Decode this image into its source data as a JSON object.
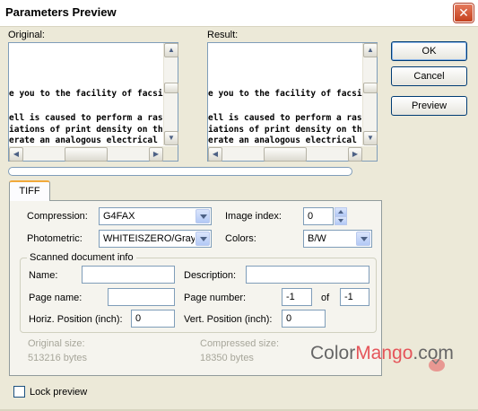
{
  "window": {
    "title": "Parameters Preview",
    "close_symbol": "✕"
  },
  "preview": {
    "original_label": "Original:",
    "result_label": "Result:",
    "lines": [
      "e you to the facility of facsimi",
      "ell is caused to perform a raste",
      "iations of print density on the ",
      "erate an analogous electrical vi"
    ]
  },
  "buttons": {
    "ok": "OK",
    "cancel": "Cancel",
    "preview": "Preview"
  },
  "progress": {
    "value": 0
  },
  "tabs": [
    {
      "label": "TIFF",
      "selected": true
    }
  ],
  "tiff": {
    "compression_label": "Compression:",
    "compression_value": "G4FAX",
    "photometric_label": "Photometric:",
    "photometric_value": "WHITEISZERO/Gray",
    "image_index_label": "Image index:",
    "image_index_value": "0",
    "colors_label": "Colors:",
    "colors_value": "B/W",
    "scanned_title": "Scanned document info",
    "name_label": "Name:",
    "name_value": "",
    "description_label": "Description:",
    "description_value": "",
    "page_name_label": "Page name:",
    "page_name_value": "",
    "page_number_label": "Page number:",
    "page_number_value": "-1",
    "of_label": "of",
    "page_total_value": "-1",
    "horiz_label": "Horiz. Position (inch):",
    "horiz_value": "0",
    "vert_label": "Vert. Position (inch):",
    "vert_value": "0",
    "original_size_label": "Original size:",
    "original_size_value": "513216 bytes",
    "compressed_size_label": "Compressed size:",
    "compressed_size_value": "18350 bytes"
  },
  "lock_preview": {
    "label": "Lock preview",
    "checked": false
  },
  "watermark": {
    "part1": "Color",
    "part2": "Mango",
    "part3": ".com"
  },
  "colors": {
    "titlebar_close": "#c4401d",
    "tab_accent": "#f1a93a",
    "border": "#7f9db9"
  }
}
